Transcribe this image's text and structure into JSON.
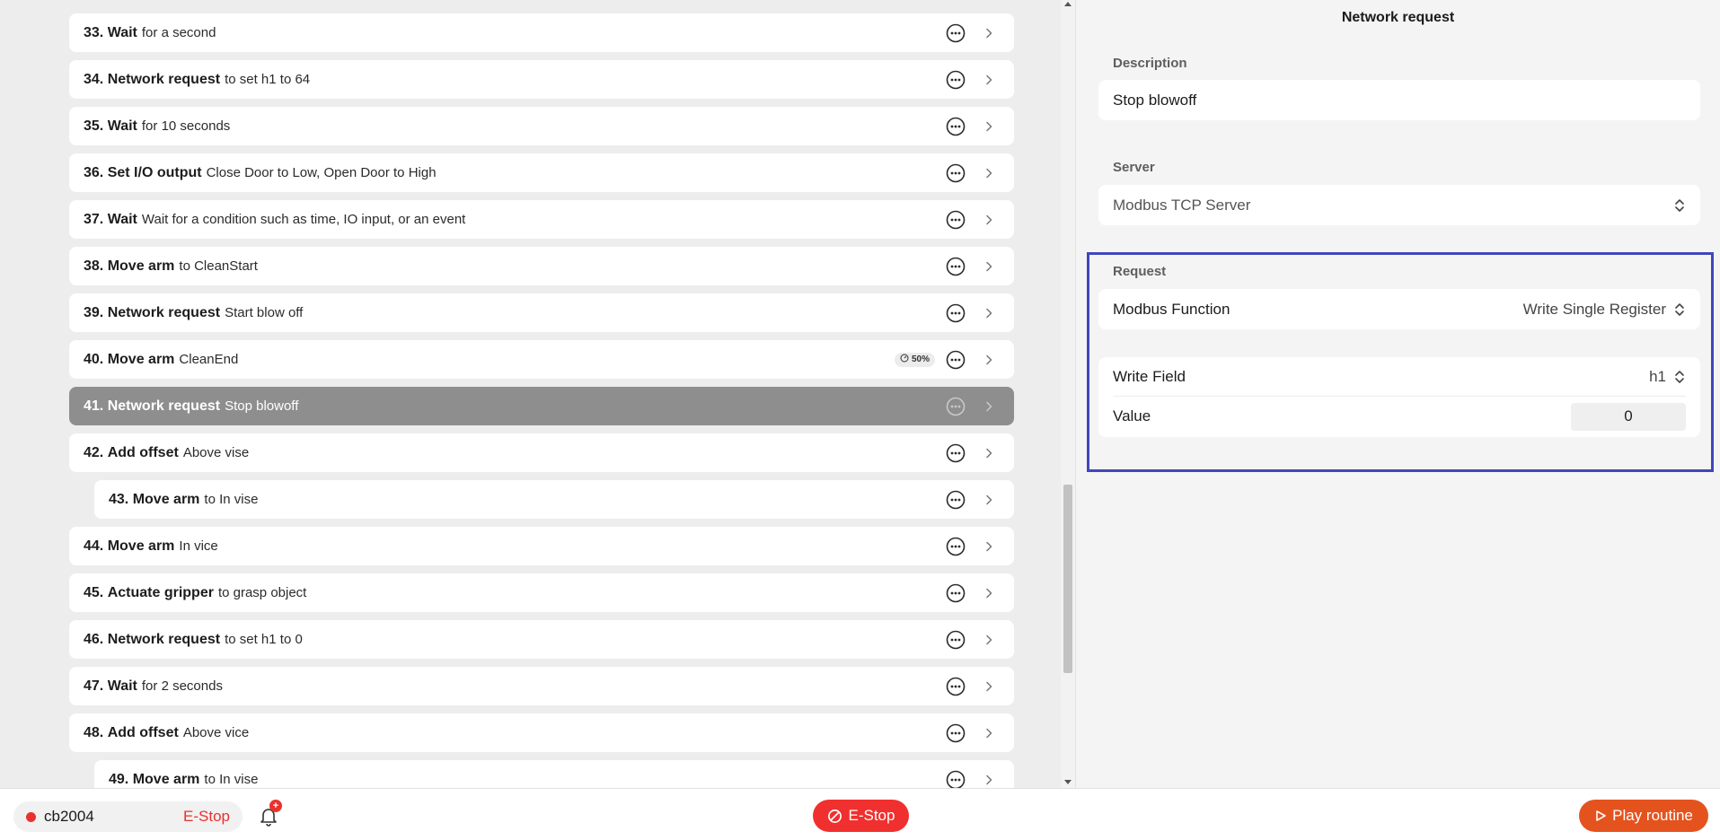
{
  "steps": [
    {
      "num": "33.",
      "title": "Wait",
      "detail": "for a second"
    },
    {
      "num": "34.",
      "title": "Network request",
      "detail": "to set h1 to 64"
    },
    {
      "num": "35.",
      "title": "Wait",
      "detail": "for 10 seconds"
    },
    {
      "num": "36.",
      "title": "Set I/O output",
      "detail": "Close Door to Low, Open Door to High"
    },
    {
      "num": "37.",
      "title": "Wait",
      "detail": "Wait for a condition such as time, IO input, or an event"
    },
    {
      "num": "38.",
      "title": "Move arm",
      "detail": "to CleanStart"
    },
    {
      "num": "39.",
      "title": "Network request",
      "detail": "Start blow off"
    },
    {
      "num": "40.",
      "title": "Move arm",
      "detail": "CleanEnd",
      "badge": "50%"
    },
    {
      "num": "41.",
      "title": "Network request",
      "detail": "Stop blowoff",
      "selected": true
    },
    {
      "num": "42.",
      "title": "Add offset",
      "detail": "Above vise"
    },
    {
      "num": "43.",
      "title": "Move arm",
      "detail": "to In vise",
      "nested": true
    },
    {
      "num": "44.",
      "title": "Move arm",
      "detail": "In vice"
    },
    {
      "num": "45.",
      "title": "Actuate gripper",
      "detail": "to grasp object"
    },
    {
      "num": "46.",
      "title": "Network request",
      "detail": "to set h1 to 0"
    },
    {
      "num": "47.",
      "title": "Wait",
      "detail": "for 2 seconds"
    },
    {
      "num": "48.",
      "title": "Add offset",
      "detail": "Above vice"
    },
    {
      "num": "49.",
      "title": "Move arm",
      "detail": "to In vise",
      "nested": true
    }
  ],
  "panel": {
    "title": "Network request",
    "description_label": "Description",
    "description_value": "Stop blowoff",
    "server_label": "Server",
    "server_value": "Modbus TCP Server",
    "request_label": "Request",
    "modbus_function_label": "Modbus Function",
    "modbus_function_value": "Write Single Register",
    "write_field_label": "Write Field",
    "write_field_value": "h1",
    "value_label": "Value",
    "value_value": "0"
  },
  "bottom": {
    "robot_name": "cb2004",
    "robot_state": "E-Stop",
    "notification_count": "+",
    "estop_label": "E-Stop",
    "play_label": "Play routine"
  },
  "colors": {
    "accent_red": "#f0302e",
    "play_orange": "#e4531e",
    "highlight_frame": "#3f47bd",
    "selected_row": "#8f8e8f"
  }
}
